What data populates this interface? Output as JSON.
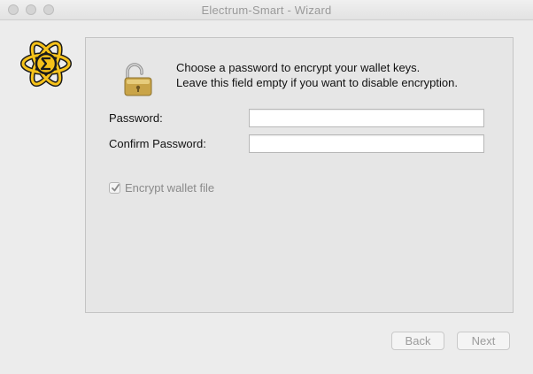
{
  "window": {
    "title": "Electrum-Smart  -  Wizard"
  },
  "icons": {
    "logo": "electrum-smart-logo-icon",
    "lock": "open-padlock-icon",
    "check": "checkmark-icon"
  },
  "colors": {
    "logo_fill": "#f6c21a",
    "logo_outline": "#1a1a1a",
    "lock_gold": "#c9a448",
    "disabled_text": "#9b9b9b"
  },
  "message": {
    "line1": "Choose a password to encrypt your wallet keys.",
    "line2": "Leave this field empty if you want to disable encryption."
  },
  "form": {
    "password_label": "Password:",
    "password_value": "",
    "confirm_label": "Confirm Password:",
    "confirm_value": "",
    "encrypt_label": "Encrypt wallet file",
    "encrypt_checked": true,
    "encrypt_enabled": false
  },
  "buttons": {
    "back_label": "Back",
    "next_label": "Next"
  }
}
